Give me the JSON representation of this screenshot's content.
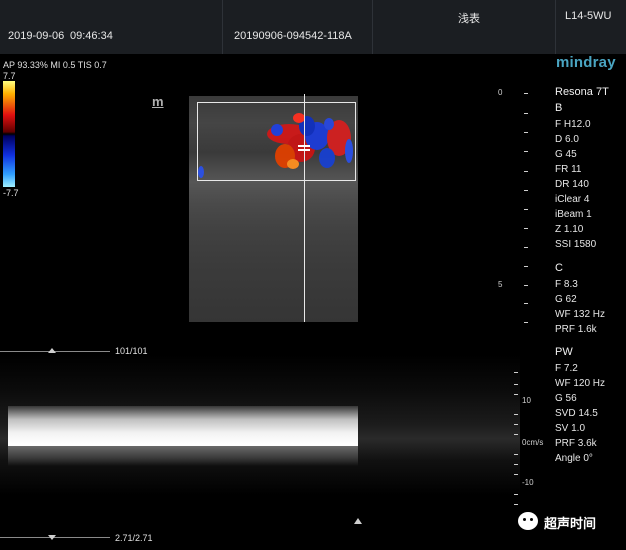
{
  "header": {
    "date": "2019-09-06",
    "time": "09:46:34",
    "exam_id": "20190906-094542-118A",
    "preset": "浅表",
    "probe": "L14-5WU"
  },
  "brand": {
    "name": "mindray",
    "model": "Resona 7T"
  },
  "status_line": "AP 93.33%  MI 0.5 TIS 0.7",
  "colorbar": {
    "max_label": "7.7",
    "min_label": "-7.7"
  },
  "b_mode": {
    "label": "B",
    "params": [
      "F H12.0",
      "D 6.0",
      "G 45",
      "FR 11",
      "DR 140",
      "iClear 4",
      "iBeam 1",
      "Z 1.10",
      "SSI 1580"
    ]
  },
  "color_mode": {
    "label": "C",
    "params": [
      "F 8.3",
      "G 62",
      "WF 132 Hz",
      "PRF 1.6k"
    ]
  },
  "pw_mode": {
    "label": "PW",
    "params": [
      "F 7.2",
      "WF 120 Hz",
      "G 56",
      "SVD 14.5",
      "SV 1.0",
      "PRF 3.6k",
      "Angle    0°"
    ]
  },
  "depth_scale": {
    "ticks": [
      "0",
      "5"
    ]
  },
  "doppler_scale": {
    "ticks": [
      "10",
      "0cm/s",
      "-10"
    ]
  },
  "frame_counter_top": "101/101",
  "frame_counter_bottom": "2.71/2.71",
  "watermark": "超声时间",
  "probe_mark": "m",
  "colors": {
    "brand": "#4aa5c2",
    "topbar": "#1b1e22"
  }
}
